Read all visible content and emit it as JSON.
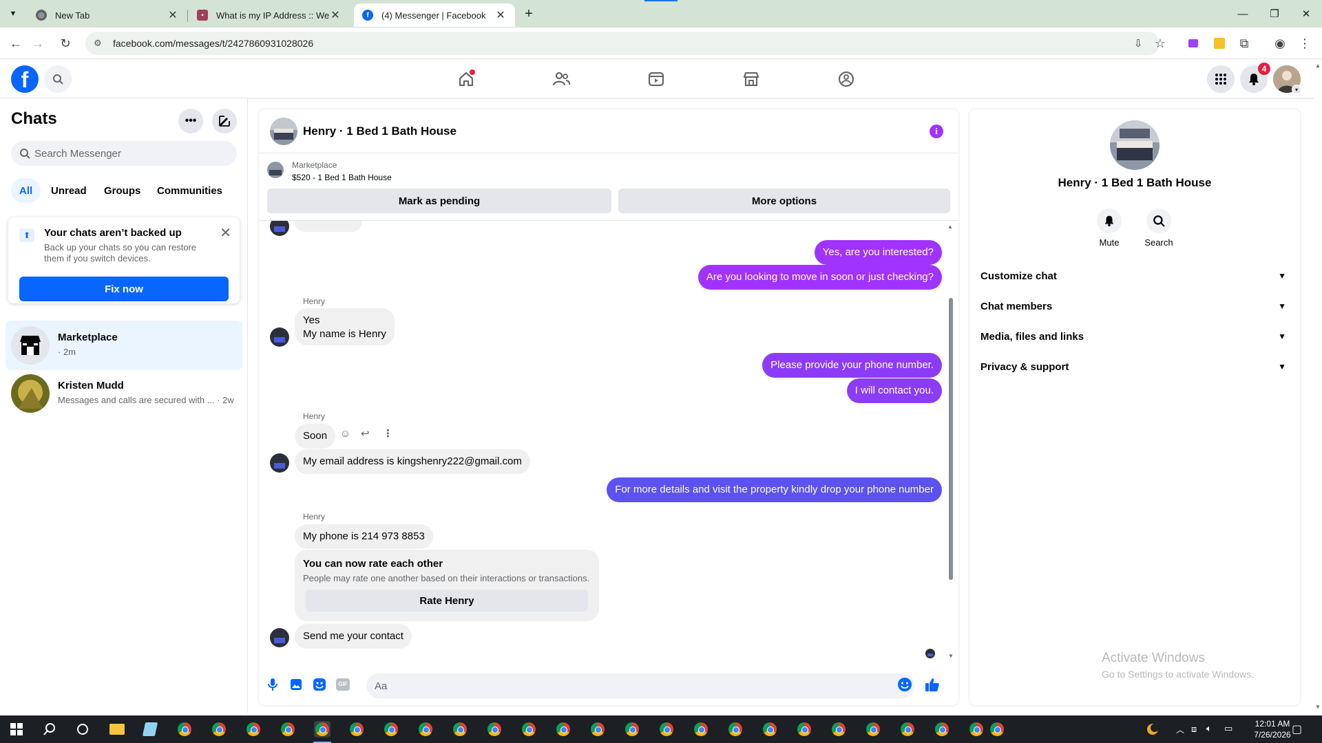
{
  "browser": {
    "tabs": [
      {
        "title": "New Tab"
      },
      {
        "title": "What is my IP Address :: WebBr"
      },
      {
        "title": "(4) Messenger | Facebook"
      }
    ],
    "url": "facebook.com/messages/t/2427860931028026"
  },
  "fb_nav": {
    "notifications_count": "4"
  },
  "sidebar": {
    "title": "Chats",
    "search_placeholder": "Search Messenger",
    "filters": [
      "All",
      "Unread",
      "Groups",
      "Communities"
    ],
    "backup_card": {
      "title": "Your chats aren’t backed up",
      "body": "Back up your chats so you can restore them if you switch devices.",
      "button": "Fix now"
    },
    "chats": [
      {
        "name": "Marketplace",
        "sub": "· 2m"
      },
      {
        "name": "Kristen Mudd",
        "sub": "Messages and calls are secured with ... · 2w"
      }
    ]
  },
  "conversation": {
    "title": "Henry · 1 Bed 1 Bath House",
    "marketplace_label": "Marketplace",
    "listing": "$520 - 1 Bed 1 Bath House",
    "mark_pending": "Mark as pending",
    "more_options": "More options",
    "outgoing_color": "#a033ff",
    "messages": {
      "out1": "Yes, are you interested?",
      "out2": "Are you looking to move in soon or just checking?",
      "sender": "Henry",
      "in1a": "Yes",
      "in1b": "My name is Henry",
      "out3": "Please provide your phone number.",
      "out4": "I will contact you.",
      "in2": "Soon",
      "in3": "My email address is kingshenry222@gmail.com",
      "out5": "For more details and visit the property kindly drop your phone number",
      "in4": "My phone is 214 973 8853",
      "in5": "Send me your contact"
    },
    "rate_card": {
      "title": "You can now rate each other",
      "body": "People may rate one another based on their interactions or transactions.",
      "button": "Rate Henry"
    },
    "composer_placeholder": "Aa"
  },
  "info_panel": {
    "name": "Henry · 1 Bed 1 Bath House",
    "actions": [
      "Mute",
      "Search"
    ],
    "sections": [
      "Customize chat",
      "Chat members",
      "Media, files and links",
      "Privacy & support"
    ]
  },
  "watermark": {
    "line1": "Activate Windows",
    "line2": "Go to Settings to activate Windows."
  },
  "taskbar": {
    "time": "12:01 AM",
    "date": "7/26/2026"
  }
}
